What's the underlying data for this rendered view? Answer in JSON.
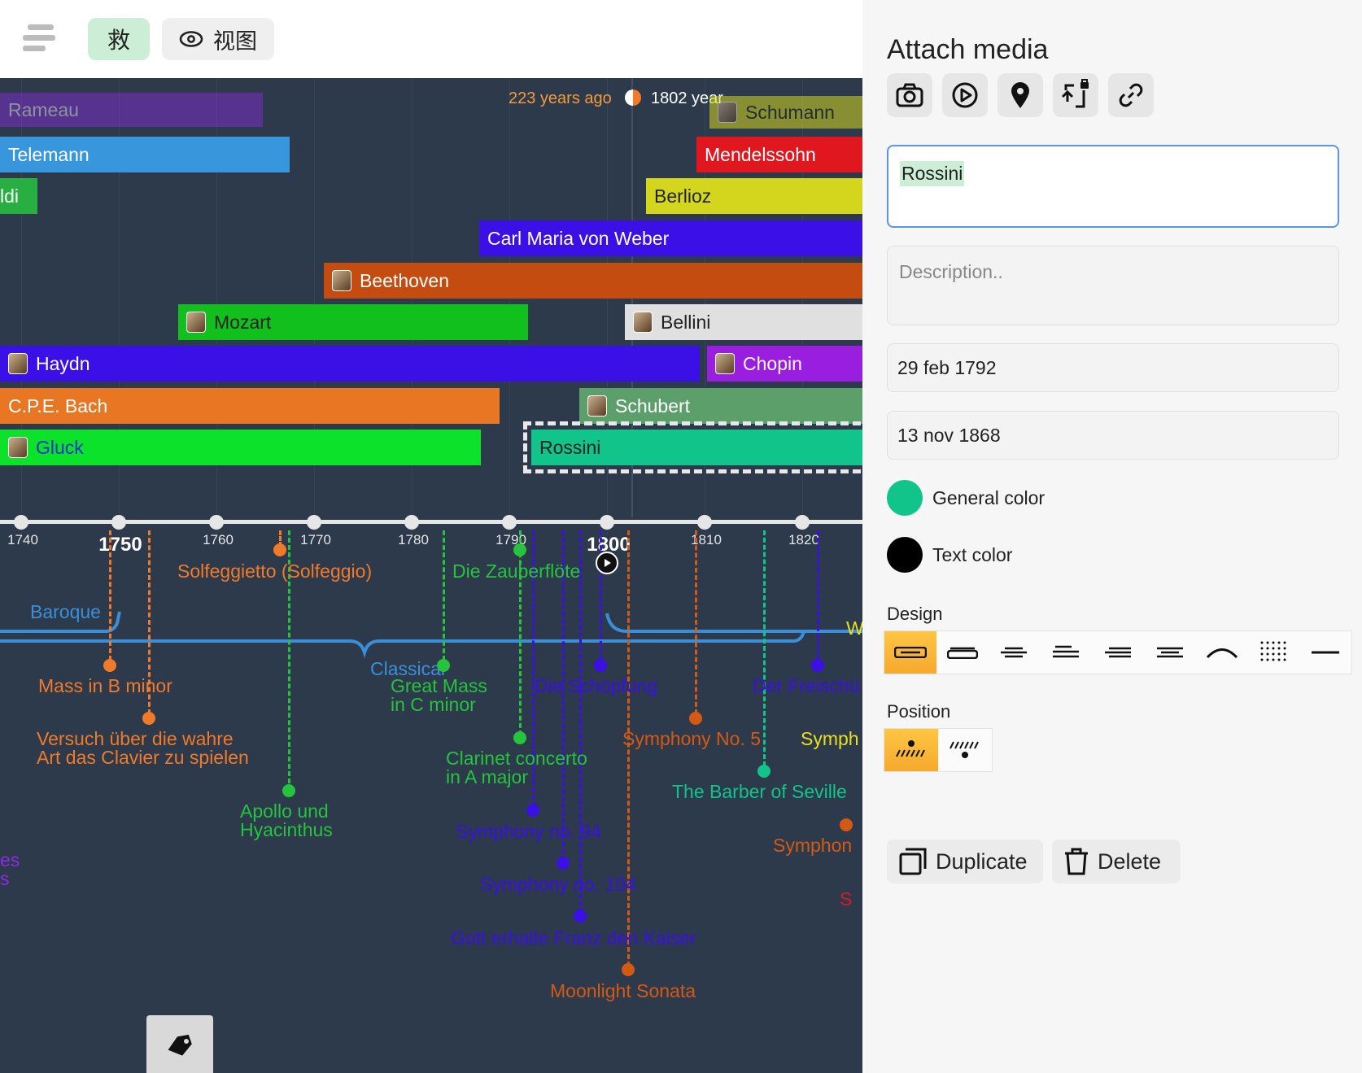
{
  "topbar": {
    "save_label": "救",
    "view_label": "视图"
  },
  "timeline": {
    "now_ago": "223 years ago",
    "now_year": "1802 year",
    "bars": [
      {
        "label": "Rameau",
        "color": "#8b2be0",
        "text": "#ffffff",
        "portrait": false
      },
      {
        "label": "Schumann",
        "color": "#d4d61e",
        "text": "#222222",
        "portrait": true
      },
      {
        "label": "Telemann",
        "color": "#3896dc",
        "text": "#ffffff",
        "portrait": false
      },
      {
        "label": "Mendelssohn",
        "color": "#e0171f",
        "text": "#ffffff",
        "portrait": false
      },
      {
        "label": "ldi",
        "color": "#27b041",
        "text": "#ffffff",
        "portrait": false
      },
      {
        "label": "Berlioz",
        "color": "#d4d61e",
        "text": "#222222",
        "portrait": false
      },
      {
        "label": "Carl Maria von Weber",
        "color": "#3a10e6",
        "text": "#ffffff",
        "portrait": false
      },
      {
        "label": "Beethoven",
        "color": "#c44c10",
        "text": "#ffffff",
        "portrait": true
      },
      {
        "label": "Mozart",
        "color": "#11c01d",
        "text": "#222222",
        "portrait": true
      },
      {
        "label": "Bellini",
        "color": "#e0e0e0",
        "text": "#222222",
        "portrait": true
      },
      {
        "label": "Haydn",
        "color": "#3a10e6",
        "text": "#ffffff",
        "portrait": true
      },
      {
        "label": "Chopin",
        "color": "#9a1ee0",
        "text": "#ffffff",
        "portrait": true
      },
      {
        "label": "C.P.E. Bach",
        "color": "#e87622",
        "text": "#ffffff",
        "portrait": false
      },
      {
        "label": "Schubert",
        "color": "#5d9f6a",
        "text": "#ffffff",
        "portrait": true
      },
      {
        "label": "Gluck",
        "color": "#0ce22a",
        "text": "#2233cc",
        "portrait": true
      },
      {
        "label": "Rossini",
        "color": "#10c48a",
        "text": "#222222",
        "portrait": false
      }
    ],
    "ticks": [
      "1740",
      "1750",
      "1760",
      "1770",
      "1780",
      "1790",
      "1800",
      "1810",
      "1820"
    ],
    "periods": [
      "Baroque",
      "Classical"
    ],
    "events": [
      {
        "label": "Solfeggietto (Solfeggio)",
        "color": "#f07a2a"
      },
      {
        "label": "Die Zauberflöte",
        "color": "#27c23e"
      },
      {
        "label": "Mass in B minor",
        "color": "#f07a2a"
      },
      {
        "label": "Great Mass\nin C minor",
        "color": "#27c23e"
      },
      {
        "label": "Die Schöpfung",
        "color": "#3a10e6"
      },
      {
        "label": "Der Freischü",
        "color": "#3a10e6"
      },
      {
        "label": "Versuch über die wahre\nArt das Clavier zu spielen",
        "color": "#f07a2a"
      },
      {
        "label": "Symphony No. 5",
        "color": "#d45a14"
      },
      {
        "label": "Symph",
        "color": "#e8e020"
      },
      {
        "label": "Clarinet concerto\nin A major",
        "color": "#27c23e"
      },
      {
        "label": "The Barber of Seville",
        "color": "#10c48a"
      },
      {
        "label": "Apollo und\nHyacinthus",
        "color": "#27c23e"
      },
      {
        "label": "Symphony no. 94",
        "color": "#3a10e6"
      },
      {
        "label": "Symphon",
        "color": "#d45a14"
      },
      {
        "label": "Symphony no. 104",
        "color": "#3a10e6"
      },
      {
        "label": "Gott erhalte Franz den Kaiser",
        "color": "#3a10e6"
      },
      {
        "label": "Moonlight Sonata",
        "color": "#d45a14"
      },
      {
        "label": "es\ns",
        "color": "#8b2be0"
      },
      {
        "label": "W",
        "color": "#e8e020"
      },
      {
        "label": "S",
        "color": "#e0171f"
      }
    ]
  },
  "panel": {
    "title": "Attach media",
    "media_buttons": [
      "camera-icon",
      "play-icon",
      "location-pin-icon",
      "import-locked-icon",
      "link-icon"
    ],
    "name_value": "Rossini",
    "description_placeholder": "Description..",
    "start_date": "29 feb 1792",
    "end_date": "13 nov 1868",
    "general_color_label": "General color",
    "general_color": "#10c48a",
    "text_color_label": "Text color",
    "text_color": "#000000",
    "design_label": "Design",
    "position_label": "Position",
    "duplicate_label": "Duplicate",
    "delete_label": "Delete"
  }
}
